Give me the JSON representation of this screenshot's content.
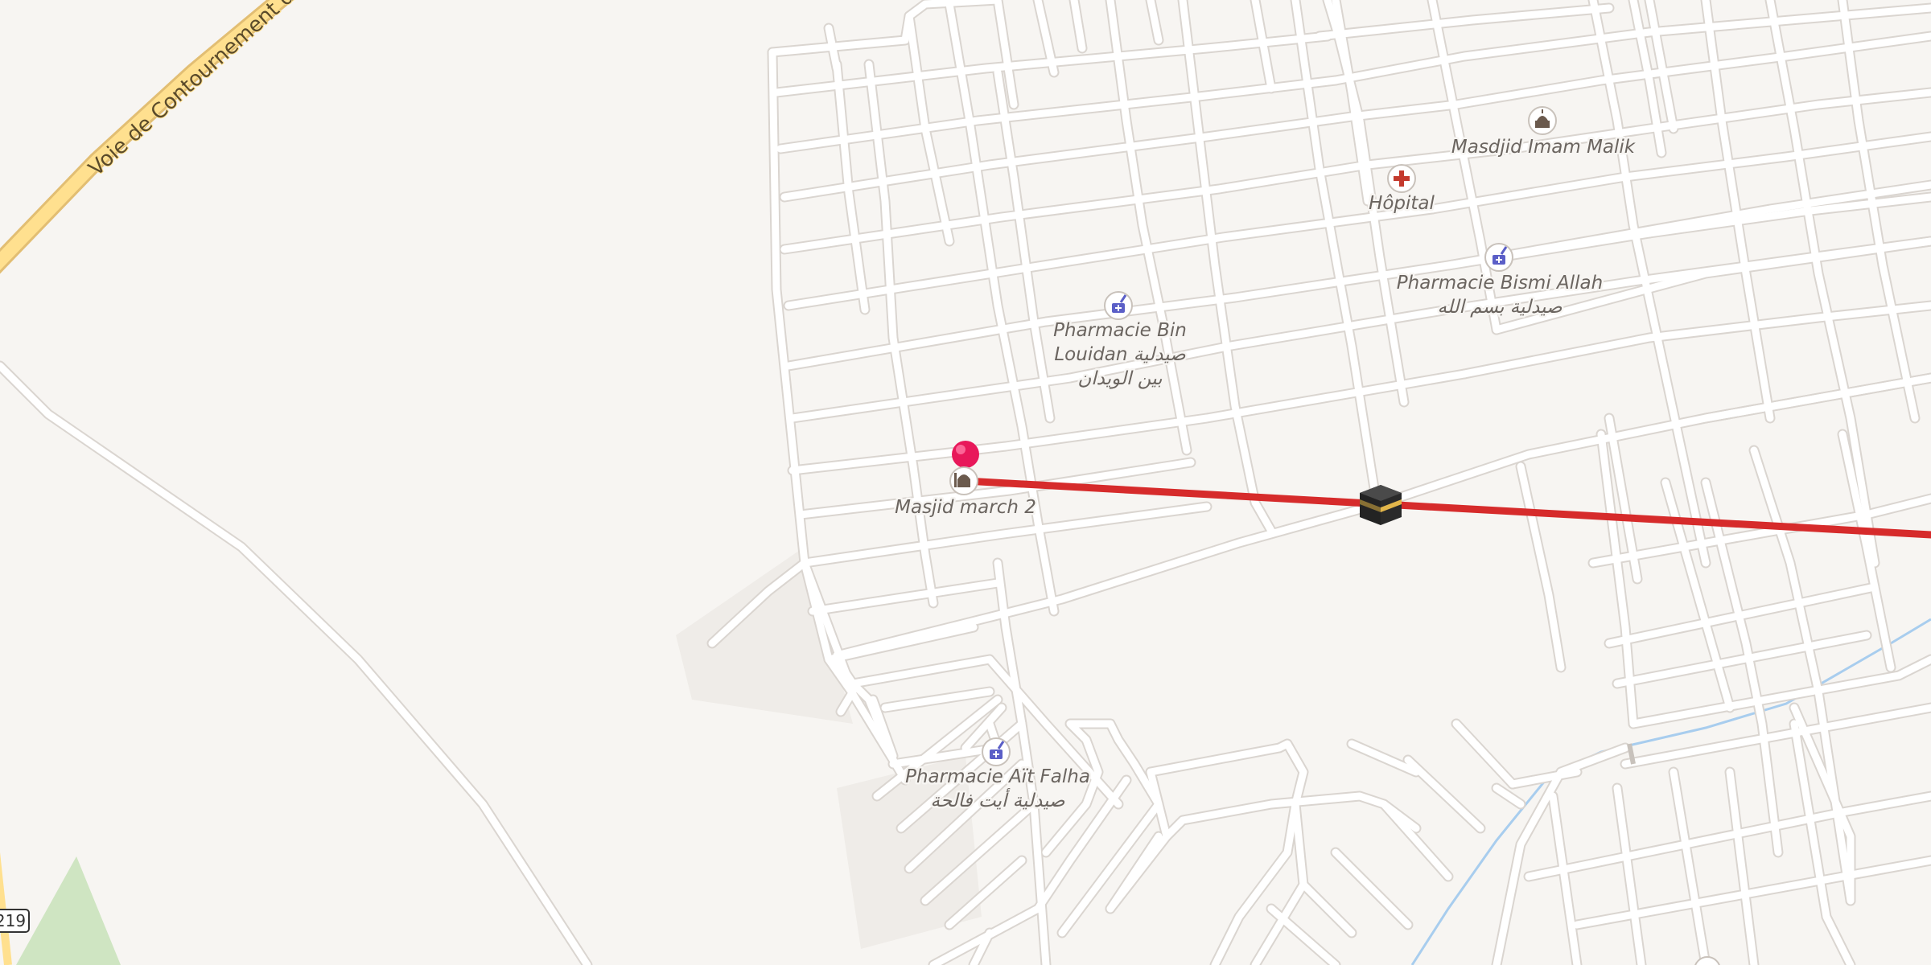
{
  "map": {
    "road_labels": {
      "bypass": "Voie de Contournement de",
      "route_shield": "219"
    },
    "pois": {
      "masjid_march_2": {
        "label": "Masjid march 2",
        "icon": "mosque-icon"
      },
      "pharmacie_bin_louidan": {
        "line1": "Pharmacie Bin",
        "line2": "Louidan صيدلية",
        "line3": "بين الويدان",
        "icon": "pharmacy-icon"
      },
      "masdjid_imam_malik": {
        "label": "Masdjid Imam Malik",
        "icon": "mosque-icon"
      },
      "hopital": {
        "label": "Hôpital",
        "icon": "hospital-icon"
      },
      "pharmacie_bismi_allah": {
        "line1": "Pharmacie Bismi Allah",
        "line2": "صيدلية بسم الله",
        "icon": "pharmacy-icon"
      },
      "pharmacie_ait_falha": {
        "line1": "Pharmacie Aït Falha",
        "line2": "صيدلية أيت فالحة",
        "icon": "pharmacy-icon"
      }
    },
    "markers": {
      "location_pin": {
        "icon": "location-pin-icon",
        "color": "#e8185a"
      },
      "kaaba": {
        "icon": "kaaba-icon"
      }
    },
    "qibla_line": {
      "color": "#d62b2b"
    },
    "colors": {
      "background": "#f7f5f2",
      "road": "#ffffff",
      "road_casing": "#d9d4cf",
      "primary_road": "#ffe08f",
      "primary_casing": "#e2be73",
      "water": "#a8cdee",
      "park": "#cfe5c2",
      "mosque_icon": "#6b5a4d",
      "pharmacy_icon": "#5b5fc7",
      "hospital_icon": "#c43a2e"
    }
  }
}
